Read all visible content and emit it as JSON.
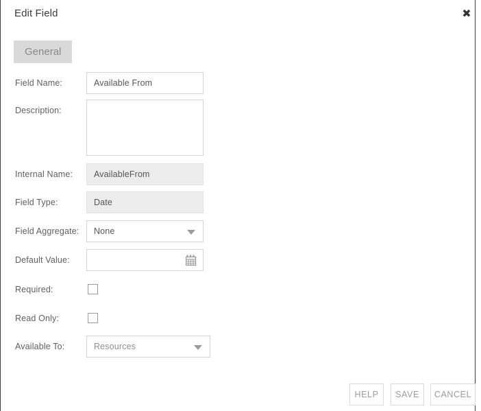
{
  "dialog": {
    "title": "Edit Field",
    "close_icon": "close-icon",
    "close_glyph": "✖"
  },
  "tabs": [
    {
      "label": "General",
      "active": true
    }
  ],
  "form": {
    "field_name": {
      "label": "Field Name:",
      "value": "Available From",
      "placeholder": ""
    },
    "description": {
      "label": "Description:",
      "value": "",
      "placeholder": ""
    },
    "internal_name": {
      "label": "Internal Name:",
      "value": "AvailableFrom",
      "readonly": true
    },
    "field_type": {
      "label": "Field Type:",
      "value": "Date",
      "readonly": true
    },
    "field_aggregate": {
      "label": "Field Aggregate:",
      "value": "None",
      "icon": "chevron-down-icon"
    },
    "default_value": {
      "label": "Default Value:",
      "value": "",
      "placeholder": "",
      "icon": "calendar-icon"
    },
    "required": {
      "label": "Required:",
      "checked": false
    },
    "read_only": {
      "label": "Read Only:",
      "checked": false
    },
    "available_to": {
      "label": "Available To:",
      "value": "Resources",
      "icon": "chevron-down-icon"
    }
  },
  "footer": {
    "help_label": "HELP",
    "save_label": "SAVE",
    "cancel_label": "CANCEL"
  },
  "colors": {
    "tab_active_bg": "#d9d9d9",
    "readonly_bg": "#ececec",
    "border": "#d4d4d4",
    "label_text": "#5f5f5f",
    "title_text": "#3b3b3b",
    "button_text": "#9b9b9b"
  }
}
